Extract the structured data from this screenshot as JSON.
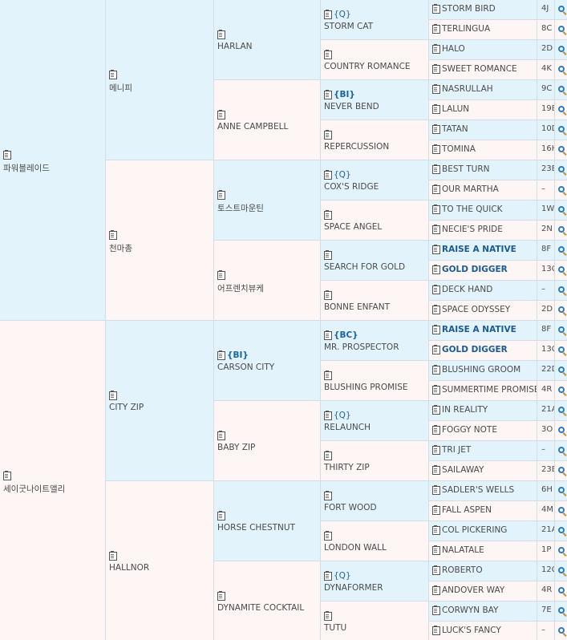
{
  "gen1": [
    {
      "name": "파워블레이드"
    },
    {
      "name": "세이굿나이트앨리"
    }
  ],
  "gen2": [
    {
      "name": "메니피"
    },
    {
      "name": "천마총"
    },
    {
      "name": "CITY ZIP"
    },
    {
      "name": "HALLNOR"
    }
  ],
  "gen3": [
    {
      "name": "HARLAN",
      "tag": ""
    },
    {
      "name": "ANNE CAMPBELL",
      "tag": ""
    },
    {
      "name": "토스트마운틴",
      "tag": ""
    },
    {
      "name": "어프렌치뷰케",
      "tag": ""
    },
    {
      "name": "CARSON CITY",
      "tag": "{BI}"
    },
    {
      "name": "BABY ZIP",
      "tag": ""
    },
    {
      "name": "HORSE CHESTNUT",
      "tag": ""
    },
    {
      "name": "DYNAMITE COCKTAIL",
      "tag": ""
    }
  ],
  "gen4": [
    {
      "name": "STORM CAT",
      "tag": "{Q}"
    },
    {
      "name": "COUNTRY ROMANCE",
      "tag": ""
    },
    {
      "name": "NEVER BEND",
      "tag": "{BI}"
    },
    {
      "name": "REPERCUSSION",
      "tag": ""
    },
    {
      "name": "COX'S RIDGE",
      "tag": "{Q}"
    },
    {
      "name": "SPACE ANGEL",
      "tag": ""
    },
    {
      "name": "SEARCH FOR GOLD",
      "tag": ""
    },
    {
      "name": "BONNE ENFANT",
      "tag": ""
    },
    {
      "name": "MR. PROSPECTOR",
      "tag": "{BC}"
    },
    {
      "name": "BLUSHING PROMISE",
      "tag": ""
    },
    {
      "name": "RELAUNCH",
      "tag": "{Q}"
    },
    {
      "name": "THIRTY ZIP",
      "tag": ""
    },
    {
      "name": "FORT WOOD",
      "tag": ""
    },
    {
      "name": "LONDON WALL",
      "tag": ""
    },
    {
      "name": "DYNAFORMER",
      "tag": "{Q}"
    },
    {
      "name": "TUTU",
      "tag": ""
    }
  ],
  "gen5": [
    {
      "name": "STORM BIRD",
      "code": "4J",
      "bold": false
    },
    {
      "name": "TERLINGUA",
      "code": "8C",
      "bold": false
    },
    {
      "name": "HALO",
      "code": "2D",
      "bold": false
    },
    {
      "name": "SWEET ROMANCE",
      "code": "4K",
      "bold": false
    },
    {
      "name": "NASRULLAH",
      "code": "9C",
      "bold": false
    },
    {
      "name": "LALUN",
      "code": "19B",
      "bold": false
    },
    {
      "name": "TATAN",
      "code": "10D",
      "bold": false
    },
    {
      "name": "TOMINA",
      "code": "16H",
      "bold": false
    },
    {
      "name": "BEST TURN",
      "code": "23B",
      "bold": false
    },
    {
      "name": "OUR MARTHA",
      "code": "–",
      "bold": false
    },
    {
      "name": "TO THE QUICK",
      "code": "1W",
      "bold": false
    },
    {
      "name": "NECIE'S PRIDE",
      "code": "2N",
      "bold": false
    },
    {
      "name": "RAISE A NATIVE",
      "code": "8F",
      "bold": true
    },
    {
      "name": "GOLD DIGGER",
      "code": "13C",
      "bold": true
    },
    {
      "name": "DECK HAND",
      "code": "–",
      "bold": false
    },
    {
      "name": "SPACE ODYSSEY",
      "code": "2D",
      "bold": false
    },
    {
      "name": "RAISE A NATIVE",
      "code": "8F",
      "bold": true
    },
    {
      "name": "GOLD DIGGER",
      "code": "13C",
      "bold": true
    },
    {
      "name": "BLUSHING GROOM",
      "code": "22D",
      "bold": false
    },
    {
      "name": "SUMMERTIME PROMISE",
      "code": "4R",
      "bold": false
    },
    {
      "name": "IN REALITY",
      "code": "21A",
      "bold": false
    },
    {
      "name": "FOGGY NOTE",
      "code": "3O",
      "bold": false
    },
    {
      "name": "TRI JET",
      "code": "–",
      "bold": false
    },
    {
      "name": "SAILAWAY",
      "code": "23B",
      "bold": false
    },
    {
      "name": "SADLER'S WELLS",
      "code": "6H",
      "bold": false
    },
    {
      "name": "FALL ASPEN",
      "code": "4M",
      "bold": false
    },
    {
      "name": "COL PICKERING",
      "code": "21A",
      "bold": false
    },
    {
      "name": "NALATALE",
      "code": "1P",
      "bold": false
    },
    {
      "name": "ROBERTO",
      "code": "12C",
      "bold": false
    },
    {
      "name": "ANDOVER WAY",
      "code": "4R",
      "bold": false
    },
    {
      "name": "CORWYN BAY",
      "code": "7E",
      "bold": false
    },
    {
      "name": "LUCK'S FANCY",
      "code": "–",
      "bold": false
    }
  ],
  "icons": {
    "clipboard": "clipboard-icon",
    "search": "magnifier-icon"
  },
  "colors": {
    "blue_cell": "#e3f3fb",
    "pink_cell": "#fdf6f5",
    "bold_name": "#1a5a96",
    "tag": "#1a64a8"
  }
}
